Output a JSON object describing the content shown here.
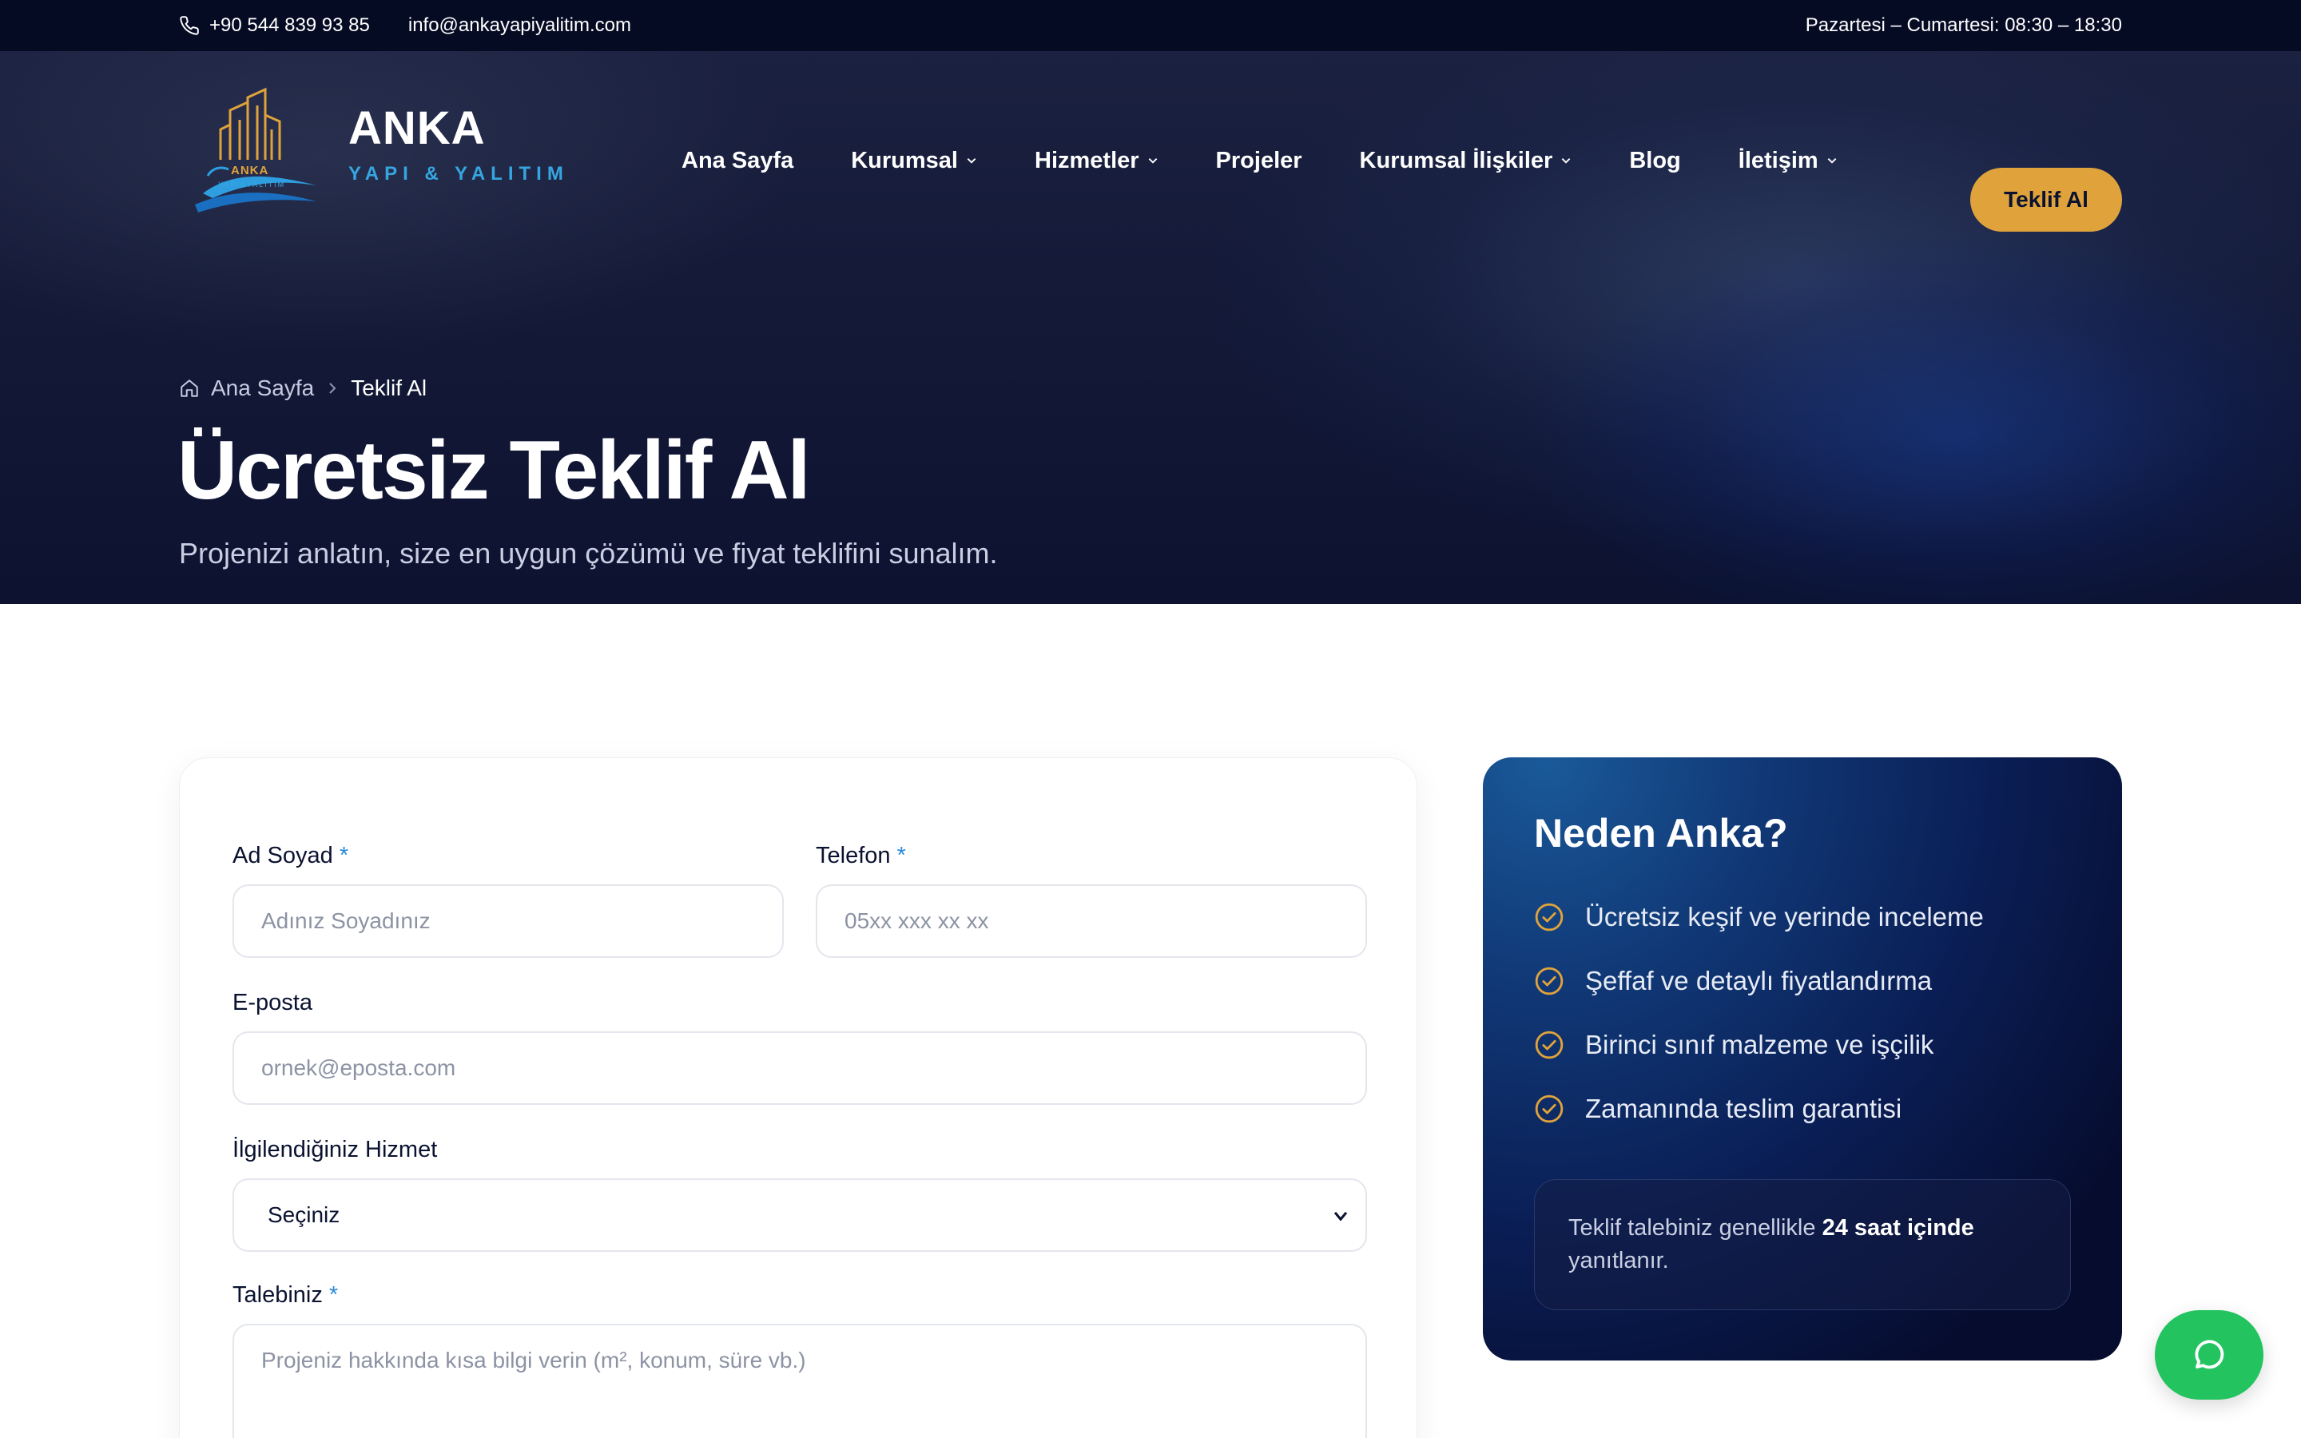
{
  "topbar": {
    "phone": "+90 544 839 93 85",
    "email": "info@ankayapiyalitim.com",
    "hours": "Pazartesi – Cumartesi: 08:30 – 18:30"
  },
  "logo": {
    "emblem_text": "ANKA",
    "emblem_subtext": "YAPI&YALITIM",
    "name": "ANKA",
    "tagline": "YAPI & YALITIM"
  },
  "nav": {
    "items": [
      {
        "label": "Ana Sayfa",
        "has_dropdown": false
      },
      {
        "label": "Kurumsal",
        "has_dropdown": true
      },
      {
        "label": "Hizmetler",
        "has_dropdown": true
      },
      {
        "label": "Projeler",
        "has_dropdown": false
      },
      {
        "label": "Kurumsal İlişkiler",
        "has_dropdown": true
      },
      {
        "label": "Blog",
        "has_dropdown": false
      },
      {
        "label": "İletişim",
        "has_dropdown": true
      }
    ],
    "cta_label": "Teklif Al"
  },
  "hero": {
    "breadcrumb_home": "Ana Sayfa",
    "breadcrumb_current": "Teklif Al",
    "title": "Ücretsiz Teklif Al",
    "subtitle": "Projenizi anlatın, size en uygun çözümü ve fiyat teklifini sunalım."
  },
  "form": {
    "name_label": "Ad Soyad",
    "name_placeholder": "Adınız Soyadınız",
    "phone_label": "Telefon",
    "phone_placeholder": "05xx xxx xx xx",
    "email_label": "E-posta",
    "email_placeholder": "ornek@eposta.com",
    "service_label": "İlgilendiğiniz Hizmet",
    "service_selected": "Seçiniz",
    "request_label": "Talebiniz",
    "request_placeholder": "Projeniz hakkında kısa bilgi verin (m², konum, süre vb.)",
    "required_mark": "*"
  },
  "why": {
    "title": "Neden Anka?",
    "benefits": [
      "Ücretsiz keşif ve yerinde inceleme",
      "Şeffaf ve detaylı fiyatlandırma",
      "Birinci sınıf malzeme ve işçilik",
      "Zamanında teslim garantisi"
    ],
    "note_prefix": "Teklif talebiniz genellikle",
    "note_bold": "24 saat içinde",
    "note_suffix": "yanıtlanır."
  },
  "colors": {
    "navy": "#060b24",
    "accent_gold": "#e0a33c",
    "accent_blue": "#35a6e0",
    "chat_green": "#23c35f"
  },
  "icons": {
    "phone": "phone-icon",
    "home": "home-icon",
    "breadcrumb_sep": "chevron-right-icon",
    "dropdown": "chevron-down-icon",
    "check": "check-circle-icon",
    "chat": "chat-bubble-icon"
  }
}
